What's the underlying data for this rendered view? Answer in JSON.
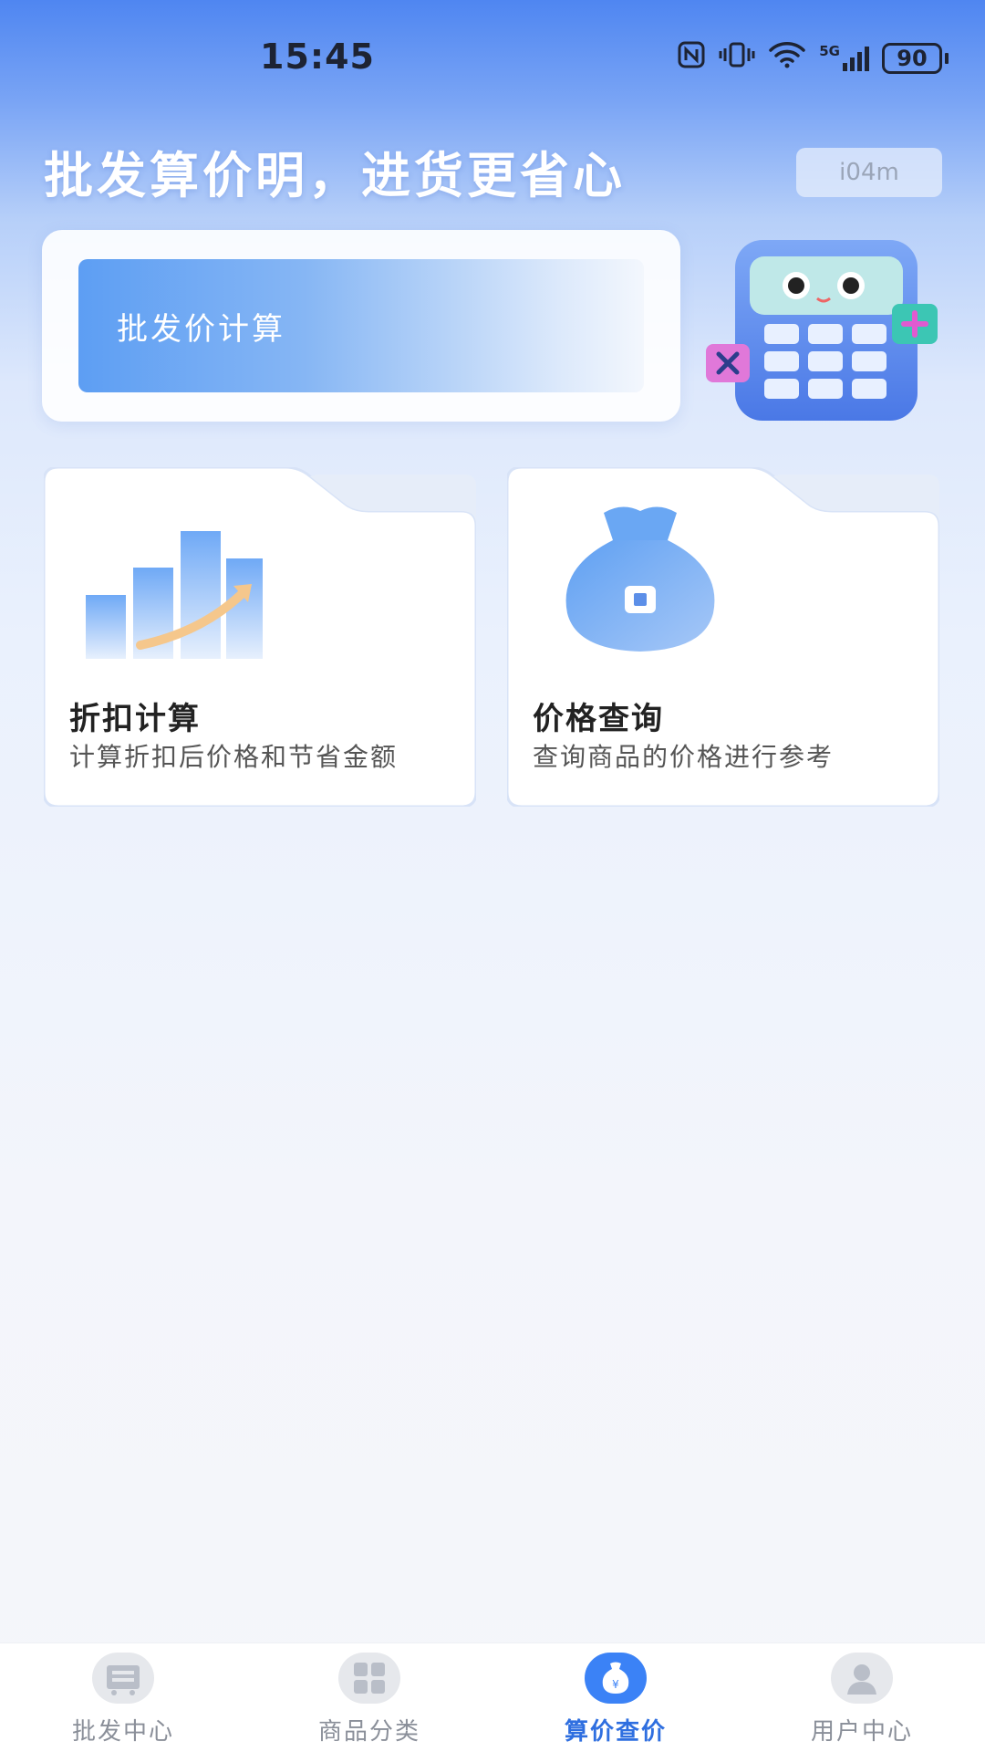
{
  "status_bar": {
    "time": "15:45",
    "network": "5G",
    "battery": "90",
    "icons": [
      "nfc-icon",
      "vibrate-icon",
      "wifi-icon",
      "signal-icon",
      "battery-icon"
    ]
  },
  "header": {
    "headline": "批发算价明，进货更省心",
    "tag": "i04m"
  },
  "banner": {
    "button_label": "批发价计算",
    "illustration": "calculator-icon"
  },
  "cards": [
    {
      "title": "折扣计算",
      "desc": "计算折扣后价格和节省金额",
      "icon": "bar-chart-growth-icon"
    },
    {
      "title": "价格查询",
      "desc": "查询商品的价格进行参考",
      "icon": "money-bag-icon"
    }
  ],
  "tabbar": {
    "items": [
      {
        "label": "批发中心",
        "icon": "store-icon",
        "active": false
      },
      {
        "label": "商品分类",
        "icon": "grid-icon",
        "active": false
      },
      {
        "label": "算价查价",
        "icon": "money-bag-icon",
        "active": true
      },
      {
        "label": "用户中心",
        "icon": "user-icon",
        "active": false
      }
    ]
  },
  "colors": {
    "accent": "#3b82f6",
    "header_gradient_top": "#4f86f1",
    "tab_active_text": "#2f6fe0",
    "tab_inactive_text": "#8a8f99"
  }
}
